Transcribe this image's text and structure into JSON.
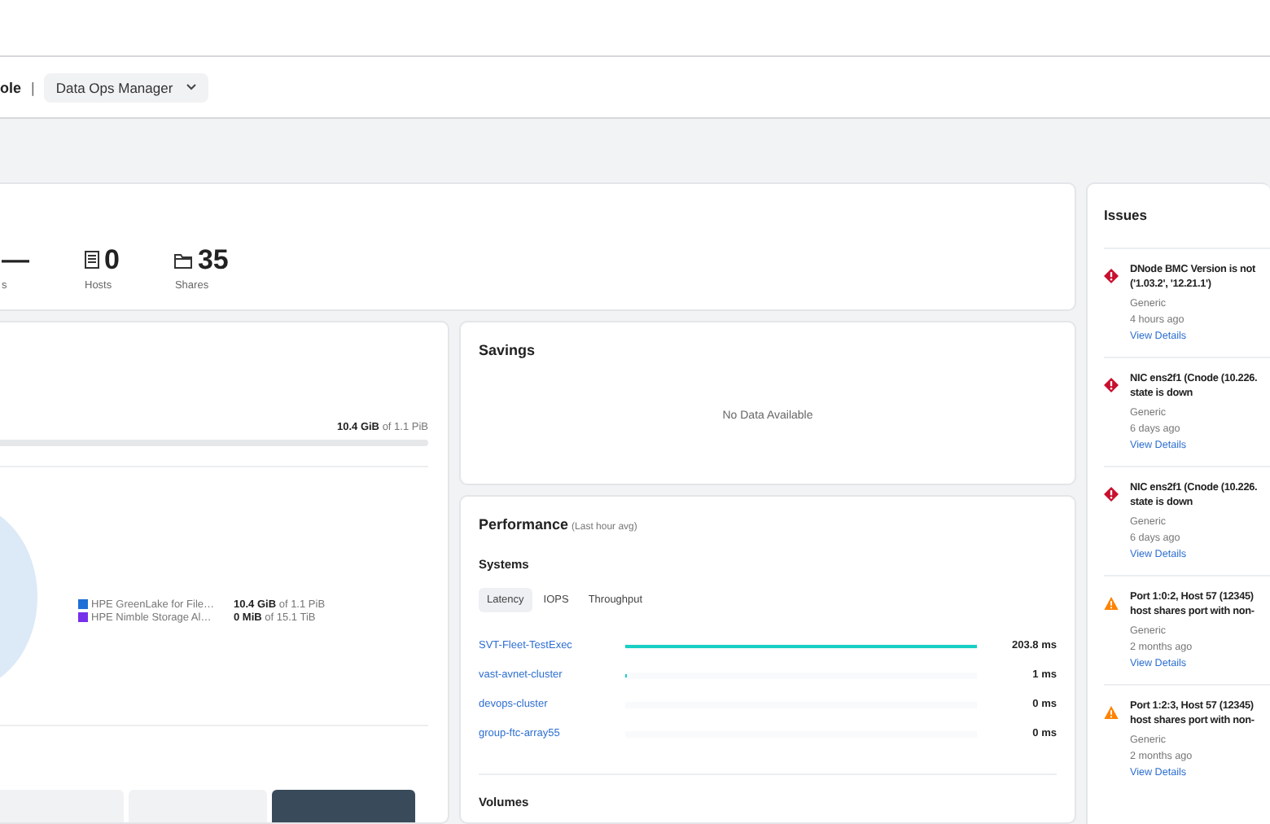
{
  "header": {
    "breadcrumb": "ole",
    "separator": "|",
    "app_switcher": "Data Ops Manager"
  },
  "summary": {
    "stats": [
      {
        "kind": "plain",
        "value": "—",
        "label": "s"
      },
      {
        "kind": "hosts",
        "value": "0",
        "label": "Hosts"
      },
      {
        "kind": "shares",
        "value": "35",
        "label": "Shares"
      }
    ]
  },
  "capacity": {
    "used": "10.4 GiB",
    "total": "of 1.1 PiB",
    "legend": [
      {
        "name": "HPE GreenLake for File…",
        "color": "#1f6fd6",
        "used": "10.4 GiB",
        "total": "of 1.1 PiB"
      },
      {
        "name": "HPE Nimble Storage Al…",
        "color": "#7630ea",
        "used": "0 MiB",
        "total": "of 15.1 TiB"
      }
    ],
    "tiles": [
      {
        "selected": false
      },
      {
        "selected": false
      },
      {
        "selected": true
      }
    ]
  },
  "savings": {
    "title": "Savings",
    "empty": "No Data Available"
  },
  "performance": {
    "title": "Performance",
    "subtitle": "(Last hour avg)",
    "section": "Systems",
    "tabs": [
      {
        "label": "Latency",
        "selected": true
      },
      {
        "label": "IOPS",
        "selected": false
      },
      {
        "label": "Throughput",
        "selected": false
      }
    ],
    "rows": [
      {
        "name": "SVT-Fleet-TestExec",
        "level": 1,
        "value": "203.8 ms"
      },
      {
        "name": "vast-avnet-cluster",
        "level": 0.005,
        "value": "1 ms"
      },
      {
        "name": "devops-cluster",
        "value": "0 ms"
      },
      {
        "name": "group-ftc-array55",
        "value": "0 ms"
      }
    ],
    "next_section": "Volumes"
  },
  "issues": {
    "title": "Issues",
    "items": [
      {
        "kind": "critical",
        "title_lines": [
          "DNode BMC Version is not",
          "('1.03.2', '12.21.1')"
        ],
        "category": "Generic",
        "time": "4 hours ago",
        "link": "View Details"
      },
      {
        "kind": "critical",
        "title_lines": [
          "NIC ens2f1 (Cnode (10.226.",
          "state is down"
        ],
        "category": "Generic",
        "time": "6 days ago",
        "link": "View Details"
      },
      {
        "kind": "critical",
        "title_lines": [
          "NIC ens2f1 (Cnode (10.226.",
          "state is down"
        ],
        "category": "Generic",
        "time": "6 days ago",
        "link": "View Details"
      },
      {
        "kind": "warning",
        "title_lines": [
          "Port 1:0:2, Host 57 (12345)",
          "host shares port with non-"
        ],
        "category": "Generic",
        "time": "2 months ago",
        "link": "View Details"
      },
      {
        "kind": "warning",
        "title_lines": [
          "Port 1:2:3, Host 57 (12345)",
          "host shares port with non-"
        ],
        "category": "Generic",
        "time": "2 months ago",
        "link": "View Details"
      }
    ]
  }
}
